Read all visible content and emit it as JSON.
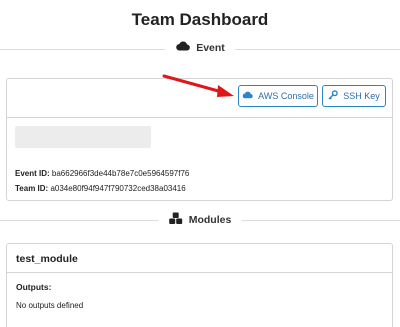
{
  "page": {
    "title": "Team Dashboard"
  },
  "event_section": {
    "heading": "Event",
    "icon": "cloud-icon",
    "buttons": [
      {
        "label": "AWS Console",
        "icon": "cloud-icon"
      },
      {
        "label": "SSH Key",
        "icon": "key-icon"
      }
    ],
    "event_id_label": "Event ID:",
    "event_id_value": "ba662966f3de44b78e7c0e5964597f76",
    "team_id_label": "Team ID:",
    "team_id_value": "a034e80f94f947f790732ced38a03416"
  },
  "modules_section": {
    "heading": "Modules",
    "icon": "cubes-icon",
    "modules": [
      {
        "name": "test_module",
        "outputs_label": "Outputs:",
        "outputs_text": "No outputs defined"
      }
    ]
  },
  "colors": {
    "accent": "#2b86c5",
    "annotation_arrow": "#e0161b"
  }
}
